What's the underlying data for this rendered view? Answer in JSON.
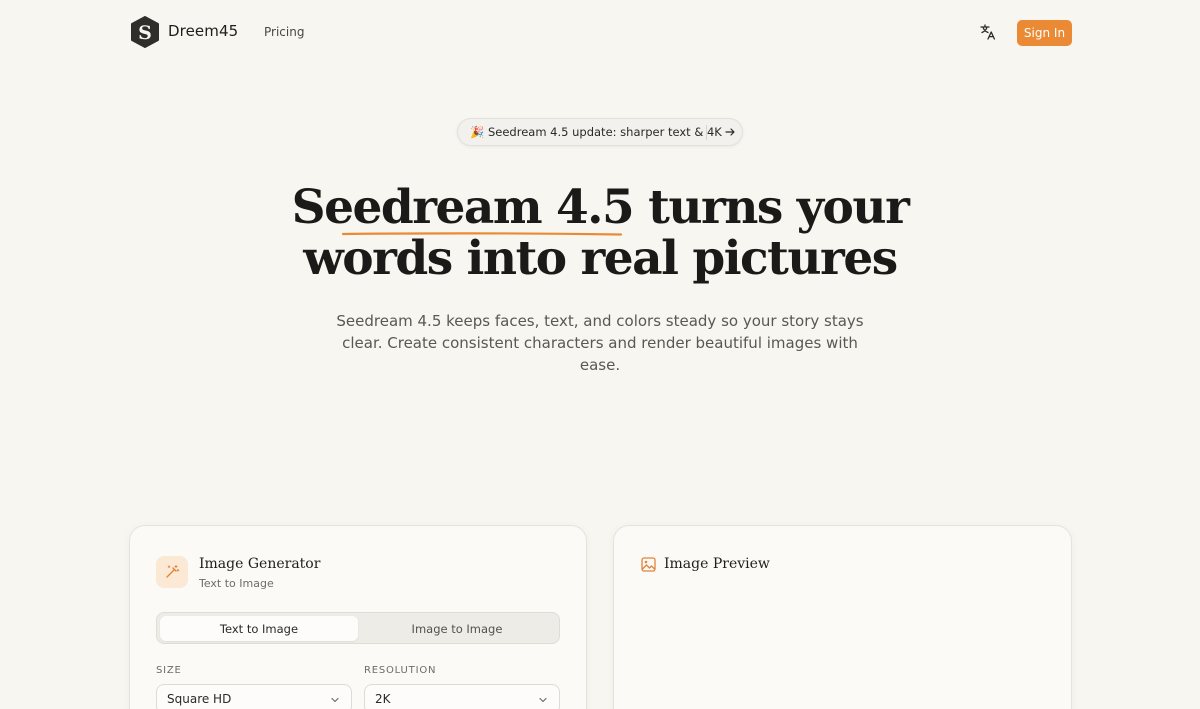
{
  "header": {
    "logo_letter": "S",
    "brand": "Dreem45",
    "nav_pricing": "Pricing",
    "signin_label": "Sign In",
    "lang_icon": "translate-icon"
  },
  "announcement": {
    "text": "🎉 Seedream 4.5 update: sharper text & 4K",
    "arrow_icon": "arrow-right-icon"
  },
  "hero": {
    "title_highlight": "Seedream 4.5",
    "title_rest_line1": " turns your",
    "title_line2": "words into real pictures",
    "subtitle": "Seedream 4.5 keeps faces, text, and colors steady so your story stays clear. Create consistent characters and render beautiful images with ease."
  },
  "generator": {
    "icon": "magic-wand-icon",
    "title": "Image Generator",
    "subtitle": "Text to Image",
    "tabs": [
      {
        "label": "Text to Image",
        "active": true
      },
      {
        "label": "Image to Image",
        "active": false
      }
    ],
    "size_label": "SIZE",
    "size_value": "Square HD",
    "resolution_label": "RESOLUTION",
    "resolution_value": "2K"
  },
  "preview": {
    "icon": "image-icon",
    "title": "Image Preview"
  },
  "colors": {
    "accent": "#ea8a35",
    "background": "#f8f6f1",
    "text": "#1b1a18"
  }
}
